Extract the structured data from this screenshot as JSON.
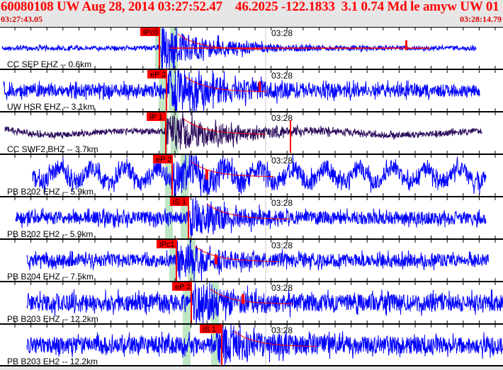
{
  "header": {
    "title": "60080108 UW Aug 28, 2014 03:27:52.47    46.2025 -122.1833  3.1 0.74 Md le amyw UW 01    4",
    "start_time": "03:27:43.05",
    "end_time": "03:28:14.79"
  },
  "colors": {
    "header_text": "#ff0000",
    "trace": "#0000ff",
    "trace_broadband": "#2a0a5a",
    "pick": "#ff0000",
    "window": "#bfe6c3",
    "axis": "#000000"
  },
  "minute_label": "03:28",
  "channels": [
    {
      "label": "CC SEP EHZ -- 0.6km",
      "pick": "iPc0"
    },
    {
      "label": "UW HSR EHZ -- 3.1km",
      "pick": "eP 2"
    },
    {
      "label": "CC SWF2 BHZ -- 3.7km",
      "pick": "iP 1"
    },
    {
      "label": "PB B202 EHZ -- 5.9km",
      "pick": "eP 2"
    },
    {
      "label": "PB B202 EH2 -- 5.9km",
      "pick": "iS 1"
    },
    {
      "label": "PB B204 EHZ -- 7.5km",
      "pick": "iPc1"
    },
    {
      "label": "PB B203 EHZ -- 12.2km",
      "pick": "eP 2"
    },
    {
      "label": "PB B203 EH2 -- 12.2km",
      "pick": "iS 1"
    }
  ]
}
